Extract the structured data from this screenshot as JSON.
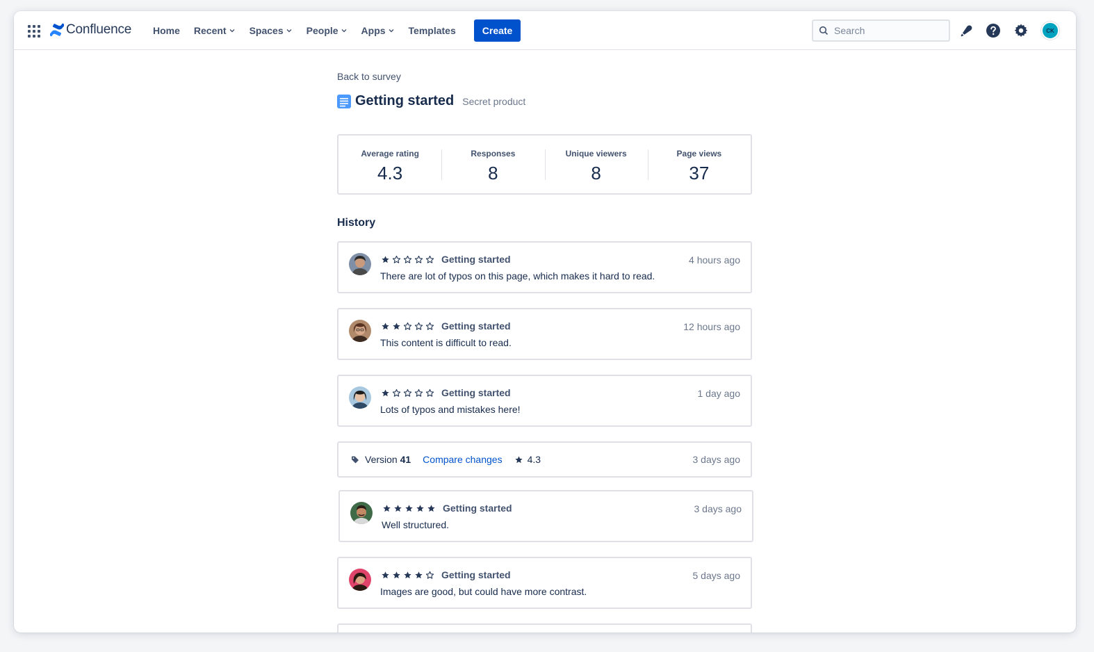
{
  "nav": {
    "logo_text": "Confluence",
    "items": [
      {
        "label": "Home",
        "dropdown": false
      },
      {
        "label": "Recent",
        "dropdown": true
      },
      {
        "label": "Spaces",
        "dropdown": true
      },
      {
        "label": "People",
        "dropdown": true
      },
      {
        "label": "Apps",
        "dropdown": true
      },
      {
        "label": "Templates",
        "dropdown": false
      }
    ],
    "create_label": "Create",
    "search_placeholder": "Search",
    "user_initials": "CK"
  },
  "page": {
    "back_label": "Back to survey",
    "title": "Getting started",
    "subtitle": "Secret product"
  },
  "stats": [
    {
      "label": "Average rating",
      "value": "4.3"
    },
    {
      "label": "Responses",
      "value": "8"
    },
    {
      "label": "Unique viewers",
      "value": "8"
    },
    {
      "label": "Page views",
      "value": "37"
    }
  ],
  "history": {
    "title": "History",
    "feedback": [
      {
        "rating": 1,
        "page": "Getting started",
        "time": "4 hours ago",
        "text": "There are lot of typos on this page, which makes it hard to read.",
        "avatar_color": "#8a6a55"
      },
      {
        "rating": 2,
        "page": "Getting started",
        "time": "12 hours ago",
        "text": "This content is difficult to read.",
        "avatar_color": "#6d4a3a"
      },
      {
        "rating": 1,
        "page": "Getting started",
        "time": "1 day ago",
        "text": "Lots of typos and mistakes here!",
        "avatar_color": "#3a3a3a"
      },
      {
        "rating": 5,
        "page": "Getting started",
        "time": "3 days ago",
        "text": "Well structured.",
        "avatar_color": "#2f5a3c"
      },
      {
        "rating": 4,
        "page": "Getting started",
        "time": "5 days ago",
        "text": "Images are good, but could have more contrast.",
        "avatar_color": "#e0446a"
      }
    ],
    "version": {
      "label": "Version",
      "number": "41",
      "compare_label": "Compare changes",
      "rating": "4.3",
      "time": "3 days ago"
    }
  },
  "colors": {
    "primary": "#0052cc",
    "text": "#172b4d",
    "subtle": "#6b778c",
    "border": "#dfe1e6"
  }
}
